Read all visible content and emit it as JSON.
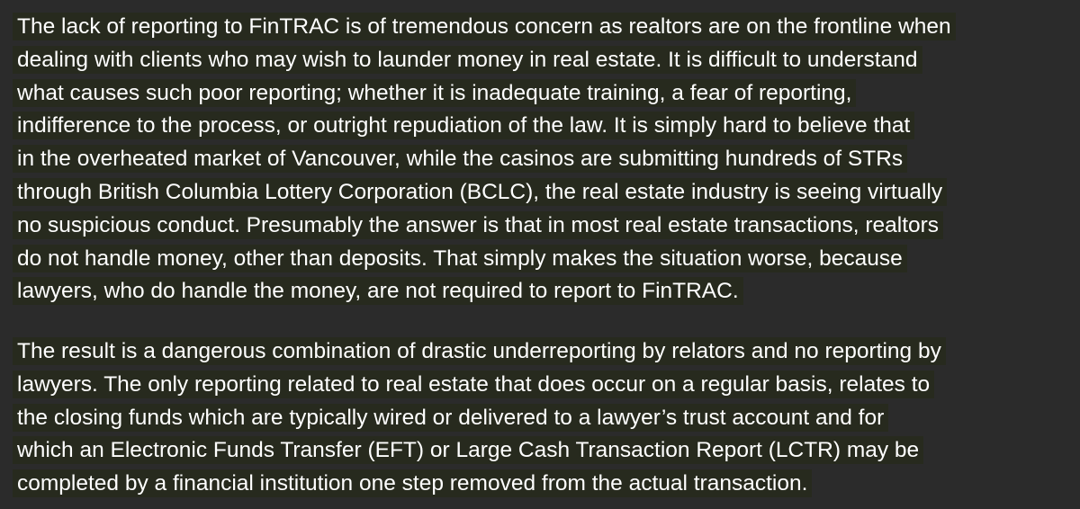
{
  "document": {
    "paragraphs": [
      {
        "lines": [
          "The lack of reporting to FinTRAC is of tremendous concern as realtors are on the frontline when",
          "dealing with clients who may wish to launder money in real estate. It is difficult to understand",
          "what causes such poor reporting; whether it is inadequate training, a fear of reporting,",
          "indifference to the process, or outright repudiation of the law. It is simply hard to believe that",
          "in the overheated market of Vancouver, while the casinos are submitting hundreds of STRs",
          "through British Columbia Lottery Corporation (BCLC), the real estate industry is seeing virtually",
          "no suspicious conduct. Presumably the answer is that in most real estate transactions, realtors",
          "do not handle money, other than deposits. That simply makes the situation worse, because",
          "lawyers, who do handle the money, are not required to report to FinTRAC."
        ]
      },
      {
        "lines": [
          "The result is a dangerous combination of drastic underreporting by relators and no reporting by",
          "lawyers. The only reporting related to real estate that does occur on a regular basis, relates to",
          "the closing funds which are typically wired or delivered to a lawyer’s trust account and for",
          "which an Electronic Funds Transfer (EFT) or Large Cash Transaction Report (LCTR) may be",
          "completed by a financial institution one step removed from the actual transaction."
        ]
      }
    ]
  },
  "colors": {
    "background": "#2b2b2b",
    "highlight": "#272a1e",
    "text": "#ffffff"
  }
}
